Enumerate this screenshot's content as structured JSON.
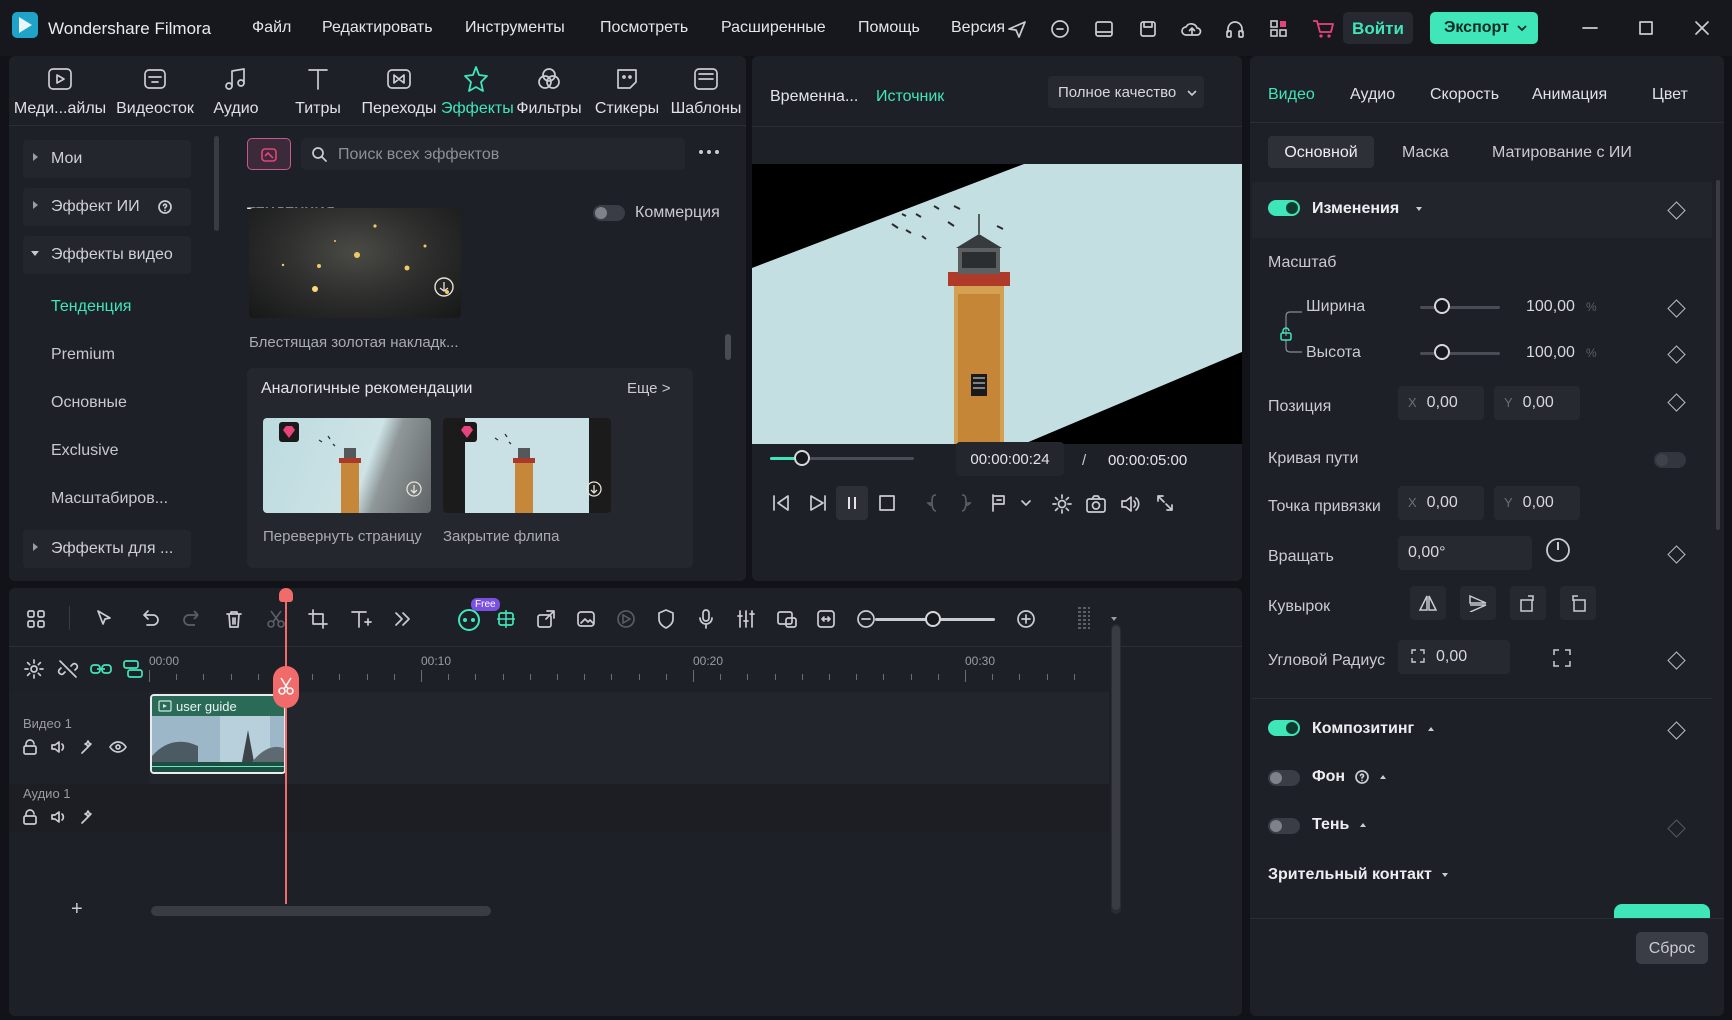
{
  "app": {
    "title": "Wondershare Filmora",
    "menu": [
      "Файл",
      "Редактировать",
      "Инструменты",
      "Посмотреть",
      "Расширенные",
      "Помощь"
    ],
    "version_label": "Версия",
    "login_label": "Войти",
    "export_label": "Экспорт"
  },
  "colors": {
    "accent": "#3ee6b8",
    "playhead": "#f26b6b",
    "pink": "#e8437b"
  },
  "media_tabs": [
    {
      "label": "Меди...айлы",
      "icon": "media-icon"
    },
    {
      "label": "Видеосток",
      "icon": "stock-icon"
    },
    {
      "label": "Аудио",
      "icon": "music-icon"
    },
    {
      "label": "Титры",
      "icon": "title-icon"
    },
    {
      "label": "Переходы",
      "icon": "transition-icon"
    },
    {
      "label": "Эффекты",
      "icon": "effects-icon"
    },
    {
      "label": "Фильтры",
      "icon": "filter-icon"
    },
    {
      "label": "Стикеры",
      "icon": "sticker-icon"
    },
    {
      "label": "Шаблоны",
      "icon": "template-icon"
    }
  ],
  "sidebar": {
    "my": "Мои",
    "ai": "Эффект ИИ",
    "video_effects": "Эффекты видео",
    "subs": [
      "Тенденция",
      "Premium",
      "Основные",
      "Exclusive",
      "Масштабиров..."
    ],
    "audio_effects": "Эффекты для ..."
  },
  "effects": {
    "search_placeholder": "Поиск всех эффектов",
    "section": "ТЕНДЕНЦИЯ",
    "commerce": "Коммерция",
    "item1": "Блестящая золотая накладк...",
    "rec_title": "Аналогичные рекомендации",
    "more": "Еще >",
    "rec": [
      "Перевернуть страницу",
      "Закрытие флипа"
    ]
  },
  "player": {
    "tab1": "Временна...",
    "tab2": "Источник",
    "quality": "Полное качество",
    "current": "00:00:00:24",
    "sep": "/",
    "total": "00:00:05:00",
    "progress": 0.22
  },
  "timeline": {
    "free_badge": "Free",
    "ruler": [
      "00:00",
      "00:10",
      "00:20",
      "00:30"
    ],
    "video_track": "Видео 1",
    "audio_track": "Аудио 1",
    "clip": "user guide",
    "add": "+"
  },
  "props": {
    "tabs": [
      "Видео",
      "Аудио",
      "Скорость",
      "Анимация",
      "Цвет"
    ],
    "subtabs": [
      "Основной",
      "Маска",
      "Матирование с ИИ"
    ],
    "transform": "Изменения",
    "scale": "Масштаб",
    "width": "Ширина",
    "height": "Высота",
    "scale_w": "100,00",
    "scale_h": "100,00",
    "pct": "%",
    "position": "Позиция",
    "x": "X",
    "y": "Y",
    "pos_x": "0,00",
    "pos_y": "0,00",
    "path": "Кривая пути",
    "anchor": "Точка привязки",
    "anc_x": "0,00",
    "anc_y": "0,00",
    "rotate": "Вращать",
    "rot_val": "0,00°",
    "flip": "Кувырок",
    "corner": "Угловой Радиус",
    "corner_val": "0,00",
    "compositing": "Композитинг",
    "bg": "Фон",
    "shadow": "Тень",
    "eye": "Зрительный контакт",
    "reset": "Сброс"
  }
}
